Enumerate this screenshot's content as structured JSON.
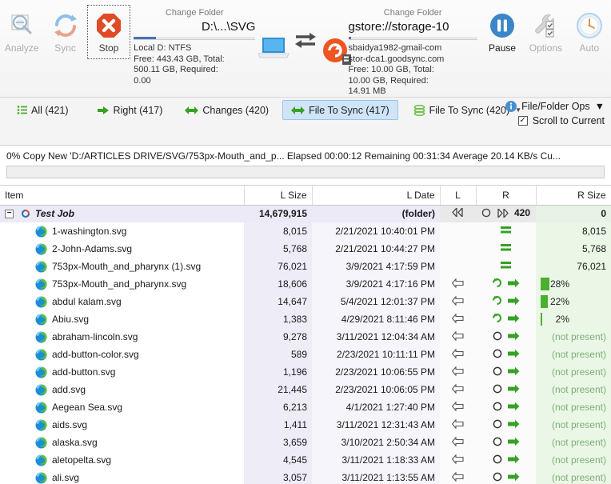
{
  "toolbar": {
    "buttons": [
      {
        "label": "Analyze",
        "icon": "analyze-icon",
        "state": "disabled"
      },
      {
        "label": "Sync",
        "icon": "sync-icon",
        "state": "disabled"
      },
      {
        "label": "Stop",
        "icon": "stop-icon",
        "state": "focused"
      }
    ],
    "right_buttons": [
      {
        "label": "Pause",
        "icon": "pause-icon",
        "state": "enabled"
      },
      {
        "label": "Options",
        "icon": "options-icon",
        "state": "disabled"
      },
      {
        "label": "Auto",
        "icon": "auto-clock-icon",
        "state": "disabled"
      }
    ],
    "left_endpoint": {
      "change_folder_label": "Change Folder",
      "path": "D:\\...\\SVG",
      "info": "Local D: NTFS Free: 443.43 GB, Total: 500.11 GB, Required: 0.00",
      "info_lines": [
        "Local D: NTFS",
        "Free: 443.43 GB, Total:",
        "500.11 GB, Required:",
        "0.00"
      ],
      "icon": "laptop-icon",
      "bar_percent": 18
    },
    "right_endpoint": {
      "change_folder_label": "Change Folder",
      "path": "gstore://storage-10",
      "info_lines": [
        "sbaidya1982-gmail-com",
        "stor-dca1.goodsync.com",
        "Free: 10.00 GB, Total:",
        "10.00 GB, Required:",
        "14.91 MB"
      ],
      "icon": "goodsync-cloud-icon",
      "bar_percent": 2
    },
    "swap_icon": "swap-arrows-icon"
  },
  "tabs": [
    {
      "label": "All (421)",
      "icon": "list-icon",
      "active": false,
      "caret": false
    },
    {
      "label": "Right (417)",
      "icon": "right-arrow-icon",
      "active": false,
      "caret": false
    },
    {
      "label": "Changes (420)",
      "icon": "left-right-arrow-icon",
      "active": false,
      "caret": false
    },
    {
      "label": "File To Sync (417)",
      "icon": "left-right-arrow-icon",
      "active": true,
      "caret": false
    },
    {
      "label": "File To Sync (420)",
      "icon": "stack-icon",
      "active": false,
      "caret": true
    }
  ],
  "ops": {
    "file_folder_ops_label": "File/Folder Ops",
    "file_folder_ops_icon": "info-icon",
    "scroll_to_current_label": "Scroll to Current",
    "scroll_to_current_checked": true
  },
  "progress": {
    "text": "0% Copy New 'D:/ARTICLES DRIVE/SVG/753px-Mouth_and_p...  Elapsed 00:00:12 Remaining 00:31:34 Average 20.14 KB/s Cu...",
    "percent": 0
  },
  "table": {
    "headers": [
      "Item",
      "L Size",
      "L Date",
      "L",
      "R",
      "R Size"
    ],
    "job_row": {
      "name": "Test Job",
      "l_size": "14,679,915",
      "l_date": "(folder)",
      "l_ind": "double-left-arrow",
      "mid_ind": "circle",
      "r_ind": "double-right-arrow",
      "r_count": "420",
      "r_size": "0",
      "icon": "goodsync-job-icon",
      "expanded": true
    },
    "rows": [
      {
        "name": "1-washington.svg",
        "l_size": "8,015",
        "l_date": "2/21/2021 10:40:01 PM",
        "state": "equal",
        "r_size": "8,015",
        "r_type": "text"
      },
      {
        "name": "2-John-Adams.svg",
        "l_size": "5,768",
        "l_date": "2/21/2021 10:44:27 PM",
        "state": "equal",
        "r_size": "5,768",
        "r_type": "text"
      },
      {
        "name": "753px-Mouth_and_pharynx (1).svg",
        "l_size": "76,021",
        "l_date": "3/9/2021 4:17:59 PM",
        "state": "equal",
        "r_size": "76,021",
        "r_type": "text"
      },
      {
        "name": "753px-Mouth_and_pharynx.svg",
        "l_size": "18,606",
        "l_date": "3/9/2021 4:17:16 PM",
        "state": "copying",
        "r_size": "28%",
        "r_type": "bar",
        "bar_percent": 28
      },
      {
        "name": "abdul kalam.svg",
        "l_size": "14,647",
        "l_date": "5/4/2021 12:01:37 PM",
        "state": "copying",
        "r_size": "22%",
        "r_type": "bar",
        "bar_percent": 22
      },
      {
        "name": "Abiu.svg",
        "l_size": "1,383",
        "l_date": "4/29/2021 8:11:46 PM",
        "state": "copying",
        "r_size": "2%",
        "r_type": "bar",
        "bar_percent": 2
      },
      {
        "name": "abraham-lincoln.svg",
        "l_size": "9,278",
        "l_date": "3/11/2021 12:04:34 AM",
        "state": "pending",
        "r_size": "(not present)",
        "r_type": "notpresent"
      },
      {
        "name": "add-button-color.svg",
        "l_size": "589",
        "l_date": "2/23/2021 10:11:11 PM",
        "state": "pending",
        "r_size": "(not present)",
        "r_type": "notpresent"
      },
      {
        "name": "add-button.svg",
        "l_size": "1,196",
        "l_date": "2/23/2021 10:06:55 PM",
        "state": "pending",
        "r_size": "(not present)",
        "r_type": "notpresent"
      },
      {
        "name": "add.svg",
        "l_size": "21,445",
        "l_date": "2/23/2021 10:06:05 PM",
        "state": "pending",
        "r_size": "(not present)",
        "r_type": "notpresent"
      },
      {
        "name": "Aegean Sea.svg",
        "l_size": "6,213",
        "l_date": "4/1/2021 1:27:40 PM",
        "state": "pending",
        "r_size": "(not present)",
        "r_type": "notpresent"
      },
      {
        "name": "aids.svg",
        "l_size": "1,411",
        "l_date": "3/11/2021 12:31:43 AM",
        "state": "pending",
        "r_size": "(not present)",
        "r_type": "notpresent"
      },
      {
        "name": "alaska.svg",
        "l_size": "3,659",
        "l_date": "3/10/2021 2:50:34 AM",
        "state": "pending",
        "r_size": "(not present)",
        "r_type": "notpresent"
      },
      {
        "name": "aletopelta.svg",
        "l_size": "4,545",
        "l_date": "3/11/2021 1:18:33 AM",
        "state": "pending",
        "r_size": "(not present)",
        "r_type": "notpresent"
      },
      {
        "name": "ali.svg",
        "l_size": "3,057",
        "l_date": "3/11/2021 1:13:55 AM",
        "state": "pending",
        "r_size": "(not present)",
        "r_type": "notpresent"
      }
    ]
  },
  "colors": {
    "accent_green": "#4caf2f",
    "accent_blue": "#3b86c8",
    "stop_red": "#e04a26",
    "tab_active_bg": "#cfe4f7",
    "row_lsize_bg": "#edecf7",
    "row_rsize_bg": "#eaf7e6"
  }
}
